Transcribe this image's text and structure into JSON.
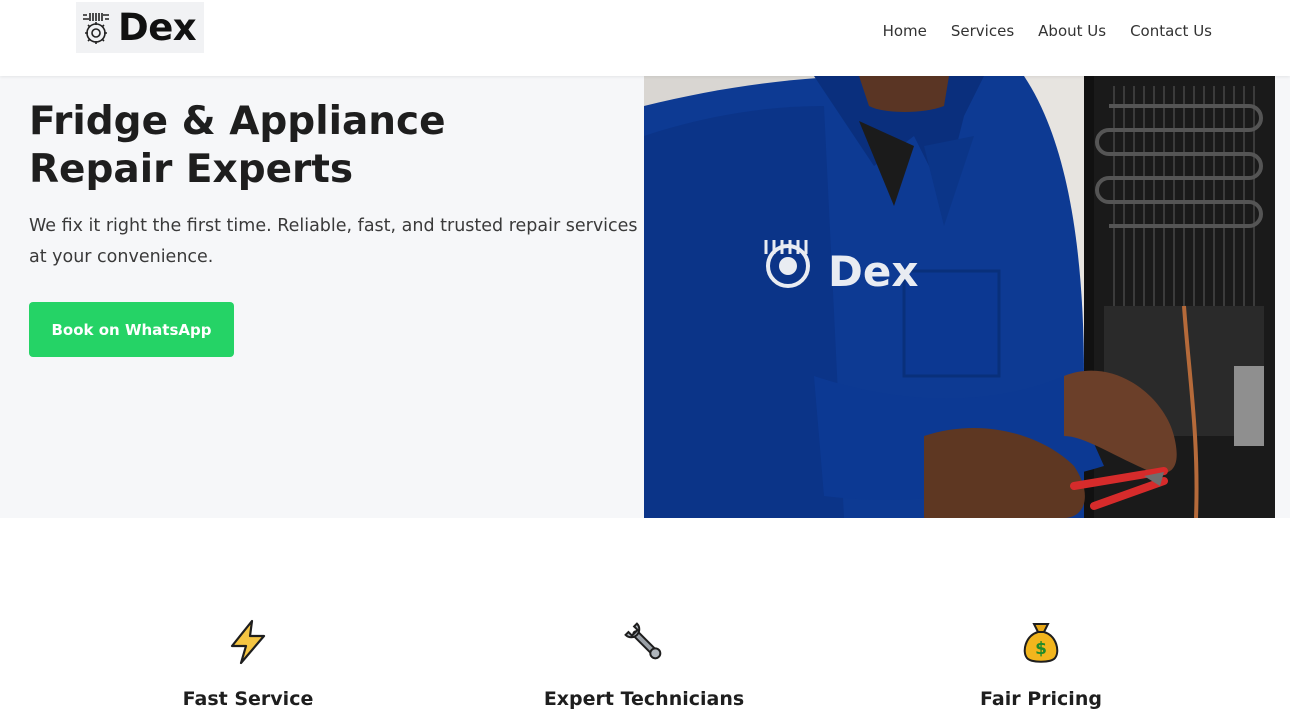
{
  "brand": {
    "name": "Dex",
    "logo_icon": "gear-wrench-logo-icon"
  },
  "nav": {
    "items": [
      {
        "label": "Home"
      },
      {
        "label": "Services"
      },
      {
        "label": "About Us"
      },
      {
        "label": "Contact Us"
      }
    ]
  },
  "hero": {
    "title": "Fridge & Appliance Repair Experts",
    "subtitle": "We fix it right the first time. Reliable, fast, and trusted repair services at your convenience.",
    "cta_label": "Book on WhatsApp",
    "cta_color": "#25d366",
    "image": {
      "icon": "technician-repairing-fridge-photo",
      "shirt_logo_text": "Dex"
    }
  },
  "features": [
    {
      "title": "Fast Service",
      "icon": "lightning-bolt-icon"
    },
    {
      "title": "Expert Technicians",
      "icon": "wrench-icon"
    },
    {
      "title": "Fair Pricing",
      "icon": "money-bag-icon"
    }
  ]
}
